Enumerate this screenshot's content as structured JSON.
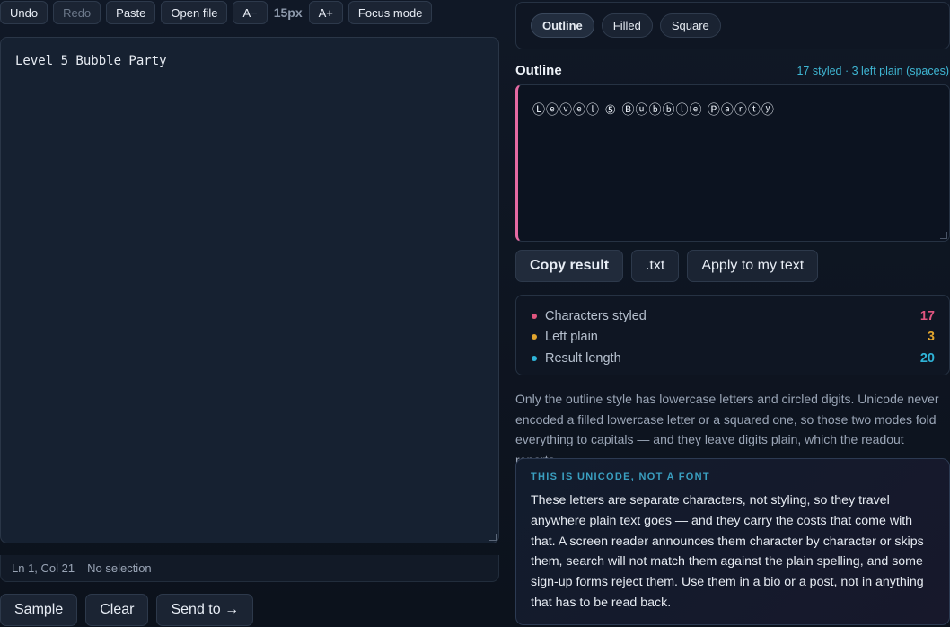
{
  "toolbar": {
    "undo": "Undo",
    "redo": "Redo",
    "paste": "Paste",
    "open_file": "Open file",
    "font_smaller": "A−",
    "font_size": "15px",
    "font_larger": "A+",
    "focus_mode": "Focus mode"
  },
  "editor": {
    "text": "Level 5 Bubble Party"
  },
  "status": {
    "position": "Ln 1, Col 21",
    "selection": "No selection"
  },
  "actions": {
    "sample": "Sample",
    "clear": "Clear",
    "send_to": "Send to →"
  },
  "styles": {
    "tabs": [
      "Outline",
      "Filled",
      "Square"
    ],
    "active": "Outline"
  },
  "output": {
    "title": "Outline",
    "meta": "17 styled · 3 left plain (spaces)",
    "result": "Ⓛⓔⓥⓔⓛ ⑤ Ⓑⓤⓑⓑⓛⓔ Ⓟⓐⓡⓣⓨ",
    "accent_color": "#e56aa3"
  },
  "result_actions": {
    "copy": "Copy result",
    "txt": ".txt",
    "apply": "Apply to my text"
  },
  "stats": [
    {
      "label": "Characters styled",
      "value": "17",
      "color": "#e0557f"
    },
    {
      "label": "Left plain",
      "value": "3",
      "color": "#e0a42e"
    },
    {
      "label": "Result length",
      "value": "20",
      "color": "#2fb4d8"
    }
  ],
  "note": "Only the outline style has lowercase letters and circled digits. Unicode never encoded a filled lowercase letter or a squared one, so those two modes fold everything to capitals — and they leave digits plain, which the readout reports.",
  "callout": {
    "eyebrow": "THIS IS UNICODE, NOT A FONT",
    "body": "These letters are separate characters, not styling, so they travel anywhere plain text goes — and they carry the costs that come with that. A screen reader announces them character by character or skips them, search will not match them against the plain spelling, and some sign-up forms reject them. Use them in a bio or a post, not in anything that has to be read back."
  }
}
